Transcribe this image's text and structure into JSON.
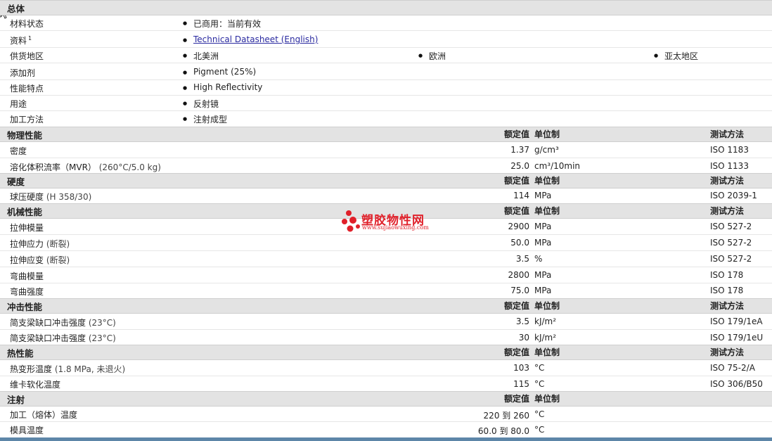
{
  "general": {
    "title": "总体",
    "rows": [
      {
        "label": "材料状态",
        "values": [
          "已商用：当前有效"
        ]
      },
      {
        "label": "资料",
        "sup": "1",
        "link": "Technical Datasheet (English)"
      },
      {
        "label": "供货地区",
        "values": [
          "北美洲",
          "欧洲",
          "亚太地区"
        ]
      },
      {
        "label": "添加剂",
        "values": [
          "Pigment (25%)"
        ]
      },
      {
        "label": "性能特点",
        "values": [
          "High Reflectivity"
        ]
      },
      {
        "label": "用途",
        "values": [
          "反射镜"
        ]
      },
      {
        "label": "加工方法",
        "values": [
          "注射成型"
        ]
      }
    ]
  },
  "headers": {
    "rated": "额定值",
    "unit": "单位制",
    "test": "测试方法"
  },
  "sections": [
    {
      "title": "物理性能",
      "rows": [
        {
          "label": "密度",
          "value": "1.37",
          "unit": "g/cm³",
          "test": "ISO 1183"
        },
        {
          "label": "溶化体积流率（MVR）",
          "sub": "(260°C/5.0 kg)",
          "value": "25.0",
          "unit": "cm³/10min",
          "test": "ISO 1133"
        }
      ]
    },
    {
      "title": "硬度",
      "rows": [
        {
          "label": "球压硬度",
          "sub": "(H 358/30)",
          "value": "114",
          "unit": "MPa",
          "test": "ISO 2039-1"
        }
      ]
    },
    {
      "title": "机械性能",
      "rows": [
        {
          "label": "拉伸模量",
          "value": "2900",
          "unit": "MPa",
          "test": "ISO 527-2"
        },
        {
          "label": "拉伸应力",
          "sub": "(断裂)",
          "value": "50.0",
          "unit": "MPa",
          "test": "ISO 527-2"
        },
        {
          "label": "拉伸应变",
          "sub": "(断裂)",
          "value": "3.5",
          "unit": "%",
          "test": "ISO 527-2"
        },
        {
          "label": "弯曲模量",
          "value": "2800",
          "unit": "MPa",
          "test": "ISO 178"
        },
        {
          "label": "弯曲强度",
          "value": "75.0",
          "unit": "MPa",
          "test": "ISO 178"
        }
      ]
    },
    {
      "title": "冲击性能",
      "rows": [
        {
          "label": "简支梁缺口冲击强度",
          "sub": "(23°C)",
          "value": "3.5",
          "unit": "kJ/m²",
          "test": "ISO 179/1eA"
        },
        {
          "label": "简支梁缺口冲击强度",
          "sub": "(23°C)",
          "value": "30",
          "unit": "kJ/m²",
          "test": "ISO 179/1eU"
        }
      ]
    },
    {
      "title": "热性能",
      "rows": [
        {
          "label": "热变形温度",
          "sub": "(1.8 MPa, 未退火)",
          "value": "103",
          "unit": "°C",
          "test": "ISO 75-2/A"
        },
        {
          "label": "维卡软化温度",
          "value": "115",
          "unit": "°C",
          "test": "ISO 306/B50"
        }
      ]
    },
    {
      "title": "注射",
      "noTest": true,
      "rows": [
        {
          "label": "加工（熔体）温度",
          "value": "220 到 260",
          "unit": "°C"
        },
        {
          "label": "模具温度",
          "value": "60.0 到 80.0",
          "unit": "°C"
        }
      ]
    }
  ],
  "watermark": {
    "brand": "塑胶物性网",
    "url": "www.sujiaowuxing.com",
    "color": "#e0202a"
  }
}
